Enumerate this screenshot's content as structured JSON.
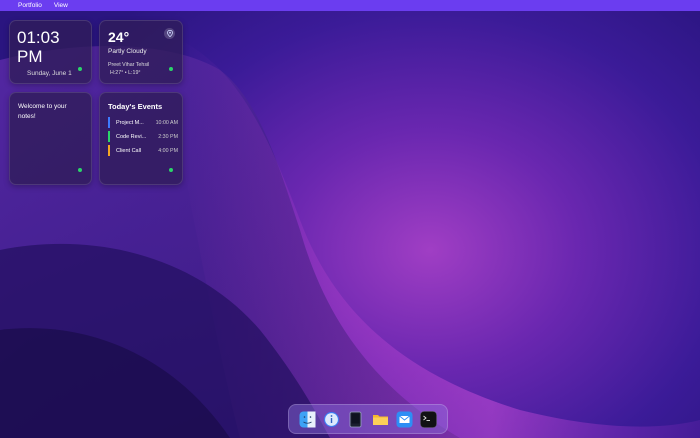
{
  "menubar": {
    "items": [
      "Portfolio",
      "View"
    ]
  },
  "clock": {
    "time": "01:03 PM",
    "date": "Sunday, June 1"
  },
  "weather": {
    "temperature": "24°",
    "condition": "Partly Cloudy",
    "location": "Preet Vihar Tehsil",
    "hilo": "H:27° • L:19°",
    "icon": "location-pin-icon"
  },
  "notes": {
    "text": "Welcome to your notes!"
  },
  "events": {
    "title": "Today's Events",
    "items": [
      {
        "title": "Project M...",
        "time": "10:00 AM",
        "color": "#3d7bff"
      },
      {
        "title": "Code Revi...",
        "time": "2:30 PM",
        "color": "#2bd46a"
      },
      {
        "title": "Client Call",
        "time": "4:00 PM",
        "color": "#f5a623"
      }
    ]
  },
  "dock": {
    "items": [
      {
        "name": "finder-icon"
      },
      {
        "name": "info-icon"
      },
      {
        "name": "book-icon"
      },
      {
        "name": "folder-icon"
      },
      {
        "name": "mail-icon"
      },
      {
        "name": "terminal-icon"
      }
    ]
  },
  "colors": {
    "menubar": "#6b3df0",
    "status_dot": "#2bd46a",
    "accent": "#3d7bff"
  }
}
